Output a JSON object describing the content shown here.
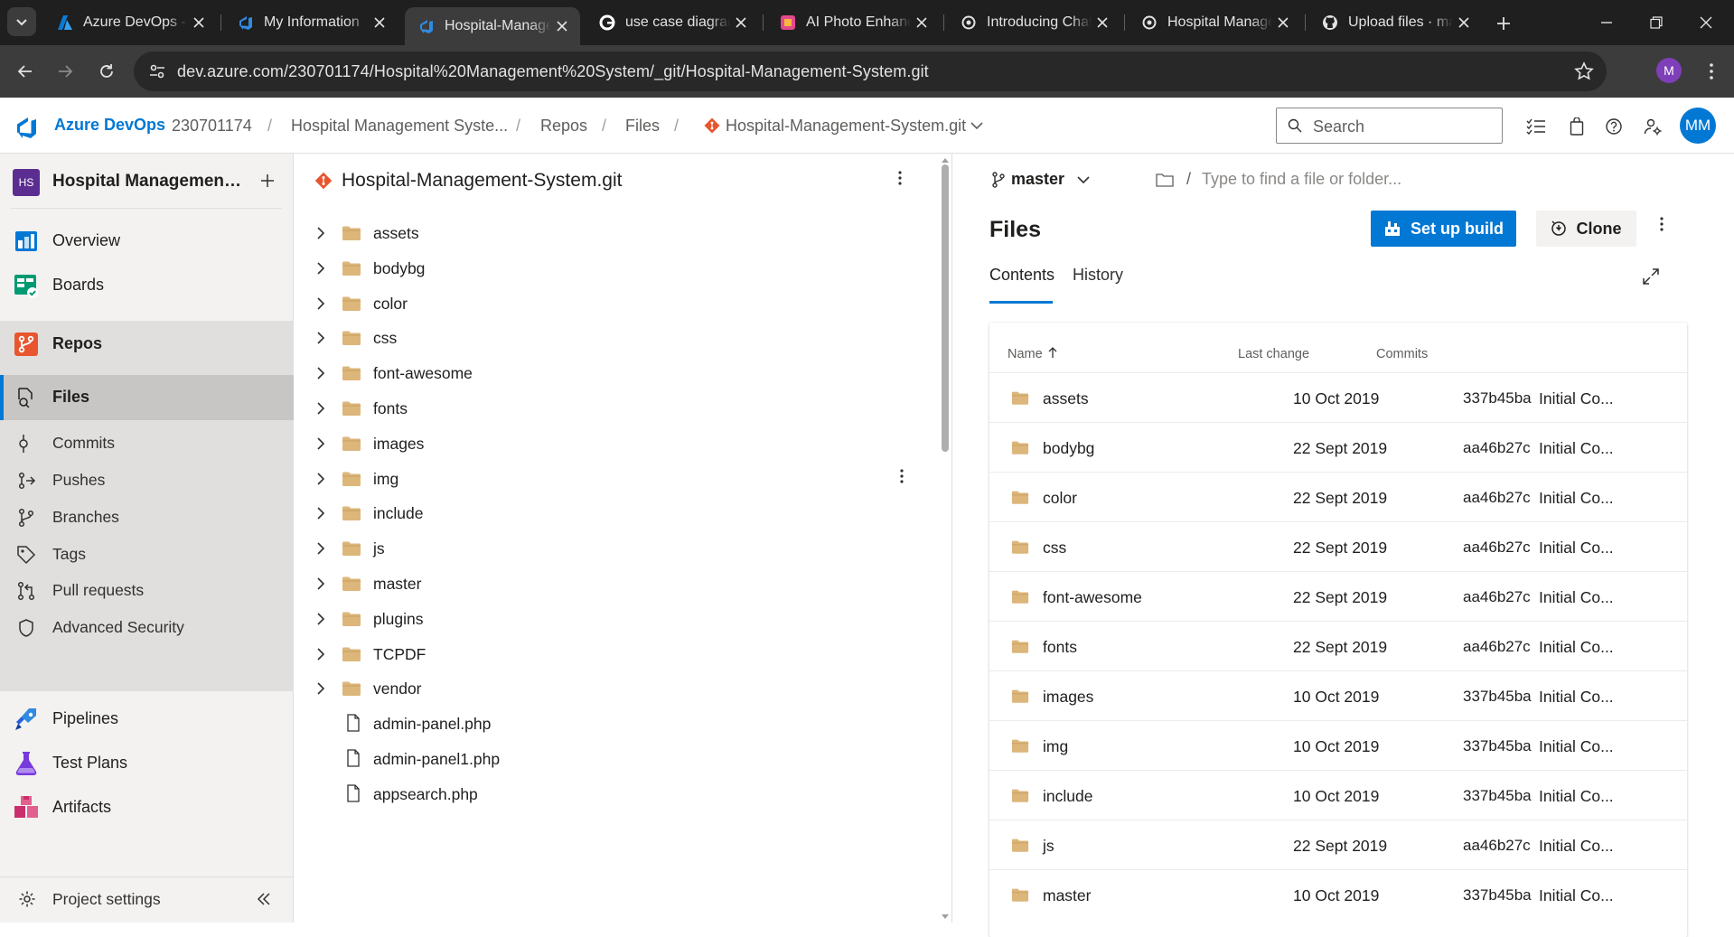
{
  "browser": {
    "tabs": [
      {
        "label": "Azure DevOps - I",
        "icon": "azure-icon"
      },
      {
        "label": "My Information",
        "icon": "azure-devops-icon"
      },
      {
        "label": "Hospital-Manage",
        "icon": "azure-devops-icon",
        "active": true
      },
      {
        "label": "use case diagram",
        "icon": "google-icon"
      },
      {
        "label": "AI Photo Enhance",
        "icon": "photo-enhancer-icon"
      },
      {
        "label": "Introducing Chat",
        "icon": "openai-icon"
      },
      {
        "label": "Hospital Manage",
        "icon": "openai-icon"
      },
      {
        "label": "Upload files · ma",
        "icon": "github-icon"
      }
    ],
    "url": "dev.azure.com/230701174/Hospital%20Management%20System/_git/Hospital-Management-System.git",
    "profile_initial": "M"
  },
  "header": {
    "brand": "Azure DevOps",
    "breadcrumbs": [
      "230701174",
      "Hospital Management Syste...",
      "Repos",
      "Files",
      "Hospital-Management-System.git"
    ],
    "search_placeholder": "Search",
    "avatar_initials": "MM"
  },
  "sidebar": {
    "project_badge": "HS",
    "project_name": "Hospital Management ...",
    "items": [
      {
        "label": "Overview",
        "icon": "overview-icon"
      },
      {
        "label": "Boards",
        "icon": "boards-icon"
      },
      {
        "label": "Repos",
        "icon": "repos-icon"
      },
      {
        "label": "Pipelines",
        "icon": "pipelines-icon"
      },
      {
        "label": "Test Plans",
        "icon": "test-plans-icon"
      },
      {
        "label": "Artifacts",
        "icon": "artifacts-icon"
      }
    ],
    "repo_subitems": [
      {
        "label": "Files",
        "icon": "files-icon",
        "selected": true
      },
      {
        "label": "Commits",
        "icon": "commits-icon"
      },
      {
        "label": "Pushes",
        "icon": "pushes-icon"
      },
      {
        "label": "Branches",
        "icon": "branches-icon"
      },
      {
        "label": "Tags",
        "icon": "tags-icon"
      },
      {
        "label": "Pull requests",
        "icon": "pull-requests-icon"
      },
      {
        "label": "Advanced Security",
        "icon": "shield-icon"
      }
    ],
    "settings_label": "Project settings"
  },
  "tree": {
    "repo_name": "Hospital-Management-System.git",
    "folders": [
      "assets",
      "bodybg",
      "color",
      "css",
      "font-awesome",
      "fonts",
      "images",
      "img",
      "include",
      "js",
      "master",
      "plugins",
      "TCPDF",
      "vendor"
    ],
    "files": [
      "admin-panel.php",
      "admin-panel1.php",
      "appsearch.php"
    ]
  },
  "files_panel": {
    "branch": "master",
    "path_placeholder": "Type to find a file or folder...",
    "title": "Files",
    "setup_build_label": "Set up build",
    "clone_label": "Clone",
    "tabs": [
      "Contents",
      "History"
    ],
    "columns": {
      "name": "Name",
      "last_change": "Last change",
      "commits": "Commits"
    },
    "rows": [
      {
        "name": "assets",
        "date": "10 Oct 2019",
        "sha": "337b45ba",
        "message": "Initial Co..."
      },
      {
        "name": "bodybg",
        "date": "22 Sept 2019",
        "sha": "aa46b27c",
        "message": "Initial Co..."
      },
      {
        "name": "color",
        "date": "22 Sept 2019",
        "sha": "aa46b27c",
        "message": "Initial Co..."
      },
      {
        "name": "css",
        "date": "22 Sept 2019",
        "sha": "aa46b27c",
        "message": "Initial Co..."
      },
      {
        "name": "font-awesome",
        "date": "22 Sept 2019",
        "sha": "aa46b27c",
        "message": "Initial Co..."
      },
      {
        "name": "fonts",
        "date": "22 Sept 2019",
        "sha": "aa46b27c",
        "message": "Initial Co..."
      },
      {
        "name": "images",
        "date": "10 Oct 2019",
        "sha": "337b45ba",
        "message": "Initial Co..."
      },
      {
        "name": "img",
        "date": "10 Oct 2019",
        "sha": "337b45ba",
        "message": "Initial Co..."
      },
      {
        "name": "include",
        "date": "10 Oct 2019",
        "sha": "337b45ba",
        "message": "Initial Co..."
      },
      {
        "name": "js",
        "date": "22 Sept 2019",
        "sha": "aa46b27c",
        "message": "Initial Co..."
      },
      {
        "name": "master",
        "date": "10 Oct 2019",
        "sha": "337b45ba",
        "message": "Initial Co..."
      }
    ]
  },
  "colors": {
    "accent": "#0078d4",
    "folder": "#dcb67a",
    "git_red": "#e8552f"
  }
}
